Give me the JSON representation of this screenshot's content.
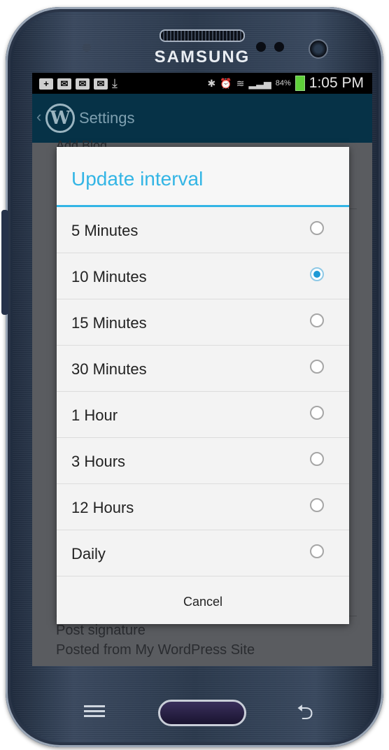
{
  "device": {
    "brand": "SAMSUNG"
  },
  "status_bar": {
    "battery_percent": "84%",
    "time": "1:05 PM",
    "icons": [
      "add-icon",
      "mail-icon",
      "mail-icon",
      "mail-icon",
      "download-icon",
      "bluetooth-icon",
      "alarm-icon",
      "wifi-icon",
      "signal-icon",
      "battery-icon"
    ]
  },
  "action_bar": {
    "title": "Settings"
  },
  "background": {
    "top_text": "Add Blog",
    "signature_label": "Post signature",
    "signature_value": "Posted from My WordPress Site"
  },
  "dialog": {
    "title": "Update interval",
    "options": [
      {
        "label": "5 Minutes",
        "selected": false
      },
      {
        "label": "10 Minutes",
        "selected": true
      },
      {
        "label": "15 Minutes",
        "selected": false
      },
      {
        "label": "30 Minutes",
        "selected": false
      },
      {
        "label": "1 Hour",
        "selected": false
      },
      {
        "label": "3 Hours",
        "selected": false
      },
      {
        "label": "12 Hours",
        "selected": false
      },
      {
        "label": "Daily",
        "selected": false
      }
    ],
    "cancel_label": "Cancel"
  },
  "colors": {
    "accent": "#33b5e5",
    "action_bar": "#063247",
    "radio_selected": "#1e9ad6"
  }
}
